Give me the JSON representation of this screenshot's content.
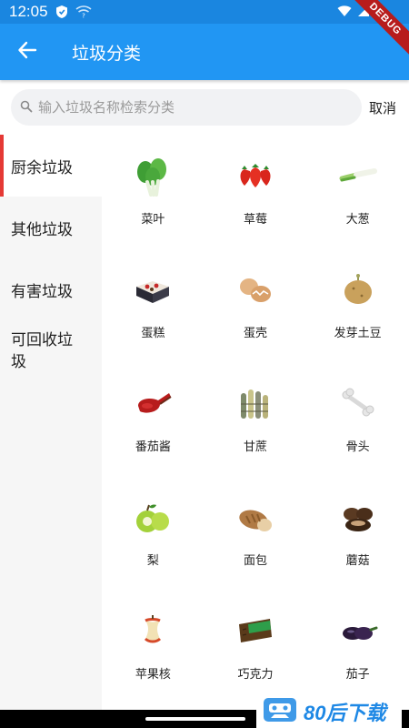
{
  "status_bar": {
    "time": "12:05"
  },
  "app_bar": {
    "title": "垃圾分类",
    "debug_label": "DEBUG"
  },
  "search": {
    "placeholder": "输入垃圾名称检索分类",
    "cancel_label": "取消"
  },
  "categories": [
    {
      "label": "厨余垃圾",
      "active": true
    },
    {
      "label": "其他垃圾",
      "active": false
    },
    {
      "label": "有害垃圾",
      "active": false
    },
    {
      "label": "可回收垃圾",
      "active": false
    }
  ],
  "items": [
    {
      "label": "菜叶",
      "icon": "leafy-greens-icon"
    },
    {
      "label": "草莓",
      "icon": "strawberry-icon"
    },
    {
      "label": "大葱",
      "icon": "scallion-icon"
    },
    {
      "label": "蛋糕",
      "icon": "cake-icon"
    },
    {
      "label": "蛋壳",
      "icon": "eggshell-icon"
    },
    {
      "label": "发芽土豆",
      "icon": "potato-icon"
    },
    {
      "label": "番茄酱",
      "icon": "ketchup-icon"
    },
    {
      "label": "甘蔗",
      "icon": "sugarcane-icon"
    },
    {
      "label": "骨头",
      "icon": "bone-icon"
    },
    {
      "label": "梨",
      "icon": "pear-icon"
    },
    {
      "label": "面包",
      "icon": "bread-icon"
    },
    {
      "label": "蘑菇",
      "icon": "mushroom-icon"
    },
    {
      "label": "苹果核",
      "icon": "apple-core-icon"
    },
    {
      "label": "巧克力",
      "icon": "chocolate-icon"
    },
    {
      "label": "茄子",
      "icon": "eggplant-icon"
    }
  ],
  "watermark": {
    "text": "80后下载"
  }
}
